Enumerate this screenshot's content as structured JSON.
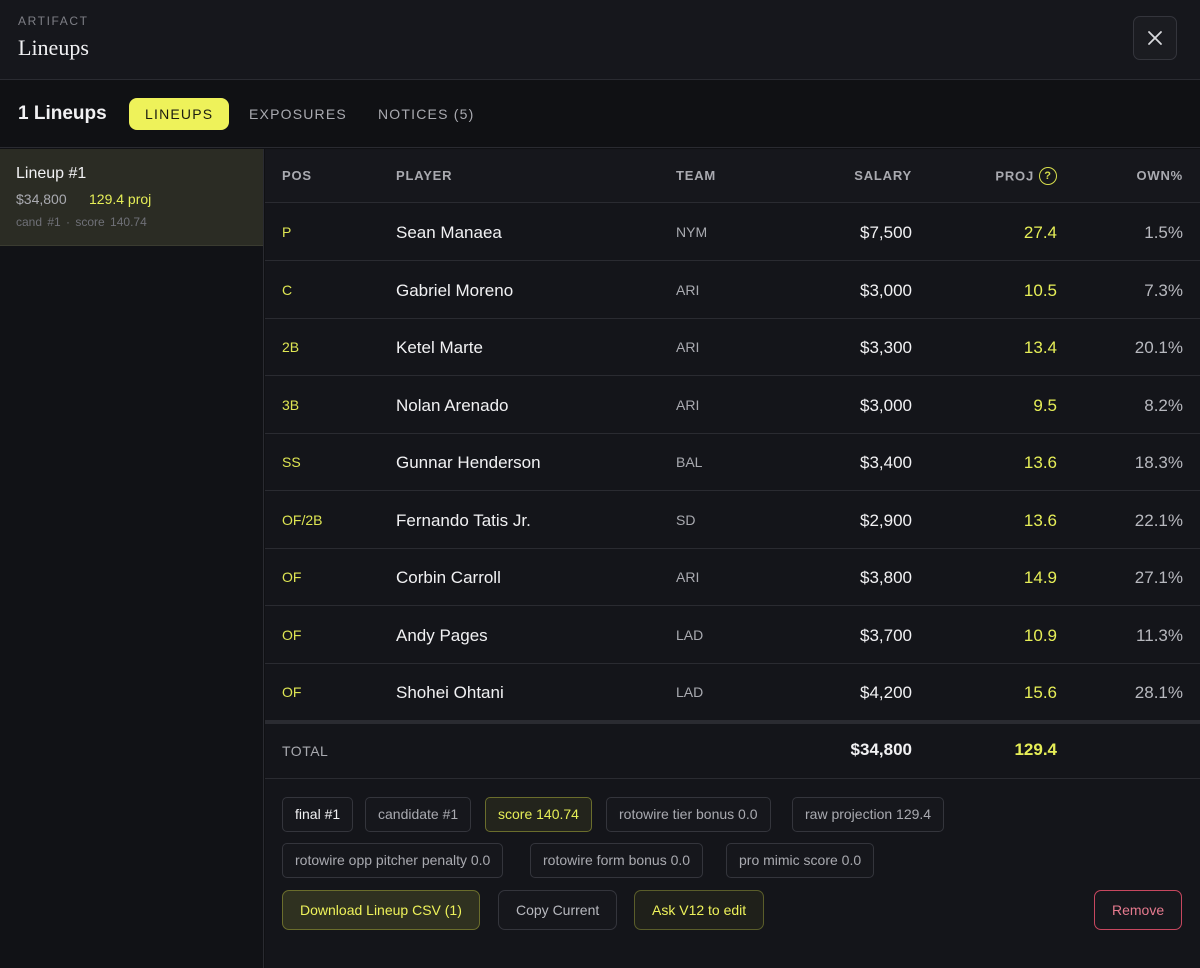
{
  "header": {
    "eyebrow": "ARTIFACT",
    "title": "Lineups"
  },
  "tabbar": {
    "count_label": "1 Lineups",
    "tabs": [
      {
        "label": "LINEUPS",
        "active": true
      },
      {
        "label": "EXPOSURES",
        "active": false
      },
      {
        "label": "NOTICES (5)",
        "active": false
      }
    ]
  },
  "sidebar": {
    "lineups": [
      {
        "name": "Lineup #1",
        "salary": "$34,800",
        "proj": "129.4 proj",
        "meta": "cand #1 · score 140.74"
      }
    ]
  },
  "table": {
    "columns": {
      "pos": "POS",
      "player": "PLAYER",
      "team": "TEAM",
      "salary": "SALARY",
      "proj": "PROJ",
      "own": "OWN%"
    },
    "help_glyph": "?",
    "rows": [
      {
        "pos": "P",
        "player": "Sean Manaea",
        "team": "NYM",
        "salary": "$7,500",
        "proj": "27.4",
        "own": "1.5%"
      },
      {
        "pos": "C",
        "player": "Gabriel Moreno",
        "team": "ARI",
        "salary": "$3,000",
        "proj": "10.5",
        "own": "7.3%"
      },
      {
        "pos": "2B",
        "player": "Ketel Marte",
        "team": "ARI",
        "salary": "$3,300",
        "proj": "13.4",
        "own": "20.1%"
      },
      {
        "pos": "3B",
        "player": "Nolan Arenado",
        "team": "ARI",
        "salary": "$3,000",
        "proj": "9.5",
        "own": "8.2%"
      },
      {
        "pos": "SS",
        "player": "Gunnar Henderson",
        "team": "BAL",
        "salary": "$3,400",
        "proj": "13.6",
        "own": "18.3%"
      },
      {
        "pos": "OF/2B",
        "player": "Fernando Tatis Jr.",
        "team": "SD",
        "salary": "$2,900",
        "proj": "13.6",
        "own": "22.1%"
      },
      {
        "pos": "OF",
        "player": "Corbin Carroll",
        "team": "ARI",
        "salary": "$3,800",
        "proj": "14.9",
        "own": "27.1%"
      },
      {
        "pos": "OF",
        "player": "Andy Pages",
        "team": "LAD",
        "salary": "$3,700",
        "proj": "10.9",
        "own": "11.3%"
      },
      {
        "pos": "OF",
        "player": "Shohei Ohtani",
        "team": "LAD",
        "salary": "$4,200",
        "proj": "15.6",
        "own": "28.1%"
      }
    ],
    "total": {
      "label": "TOTAL",
      "salary": "$34,800",
      "proj": "129.4"
    }
  },
  "chips": {
    "final": "final #1",
    "candidate": "candidate #1",
    "score": "score 140.74",
    "tier_bonus": "rotowire tier bonus 0.0",
    "raw_projection": "raw projection 129.4",
    "opp_pitcher": "rotowire opp pitcher penalty 0.0",
    "form_bonus": "rotowire form bonus 0.0",
    "pro_mimic": "pro mimic score 0.0"
  },
  "actions": {
    "download": "Download Lineup CSV (1)",
    "copy": "Copy Current",
    "ask": "Ask V12 to edit",
    "remove": "Remove"
  },
  "colors": {
    "accent": "#eef25a",
    "background": "#101114",
    "danger": "#c7475f"
  }
}
